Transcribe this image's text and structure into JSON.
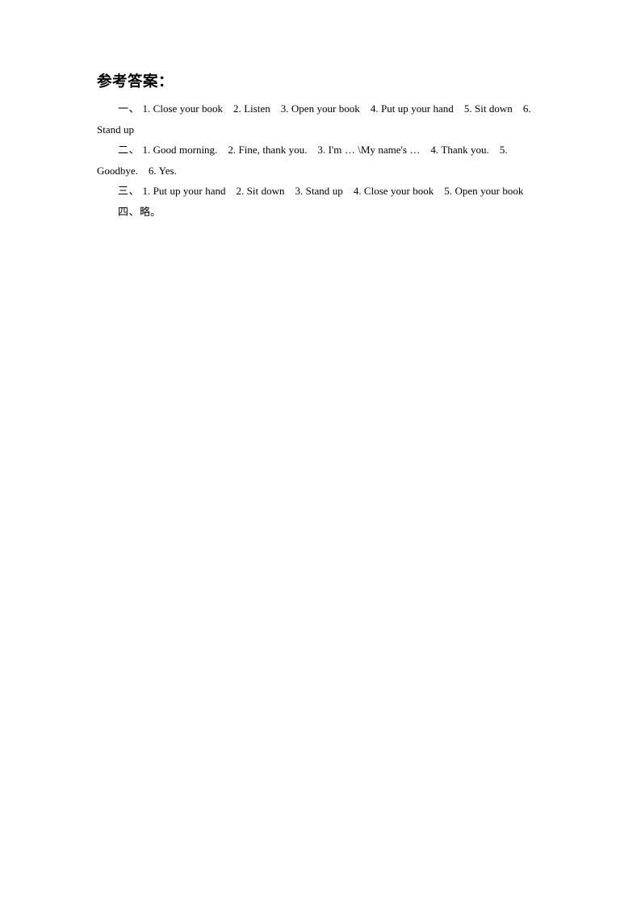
{
  "document": {
    "title": "参考答案：",
    "sections": [
      {
        "label": "一、",
        "items": [
          "1. Close your book",
          "2. Listen",
          "3. Open your book",
          "4. Put up your hand",
          "5. Sit down",
          "6. Stand up"
        ]
      },
      {
        "label": "二、",
        "items": [
          "1. Good morning.",
          "2. Fine, thank you.",
          "3. I'm … \\My name's …",
          "4. Thank you.",
          "5. Goodbye.",
          "6. Yes."
        ]
      },
      {
        "label": "三、",
        "items": [
          "1. Put up your hand",
          "2. Sit down",
          "3. Stand up",
          "4. Close your book",
          "5. Open your book"
        ]
      },
      {
        "label": "四、",
        "items": [
          "略。"
        ]
      }
    ]
  }
}
